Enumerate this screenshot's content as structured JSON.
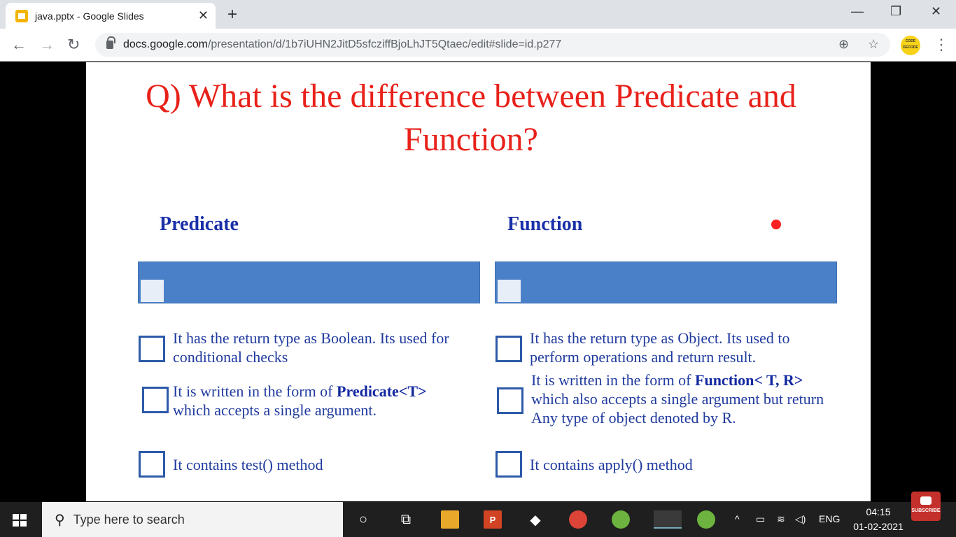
{
  "browser": {
    "tab_title": "java.pptx - Google Slides",
    "tab_close": "✕",
    "new_tab": "+",
    "url_domain": "docs.google.com",
    "url_path": "/presentation/d/1b7iUHN2JitD5sfcziffBjoLhJT5Qtaec/edit#slide=id.p277",
    "profile_text": "CODE DECODE",
    "window_controls": [
      "—",
      "❐",
      "✕"
    ]
  },
  "slide": {
    "title": "Q) What is the difference between Predicate and Function?",
    "predicate": {
      "heading": "Predicate",
      "items": [
        {
          "pre": "It has the return type as Boolean. Its used for conditional checks",
          "bold": "",
          "post": ""
        },
        {
          "pre": "It is written in the form of ",
          "bold": "Predicate<T>",
          "post": " which accepts a single argument."
        },
        {
          "pre": "It contains test()  method",
          "bold": "",
          "post": ""
        }
      ]
    },
    "function": {
      "heading": "Function",
      "items": [
        {
          "pre": "It has the return type as Object. Its used to perform operations and return result.",
          "bold": "",
          "post": ""
        },
        {
          "pre": "It is written in the form of ",
          "bold": "Function< T, R>",
          "post": " which also accepts a single argument but return Any type of object denoted by R."
        },
        {
          "pre": "It contains apply() method",
          "bold": "",
          "post": ""
        }
      ]
    }
  },
  "taskbar": {
    "search_placeholder": "Type here to search",
    "language": "ENG",
    "time": "04:15",
    "date": "01-02-2021",
    "subscribe": "SUBSCRIBE"
  },
  "colors": {
    "title": "#e8211a",
    "heading": "#1a30a8",
    "bar": "#4a80c8"
  }
}
